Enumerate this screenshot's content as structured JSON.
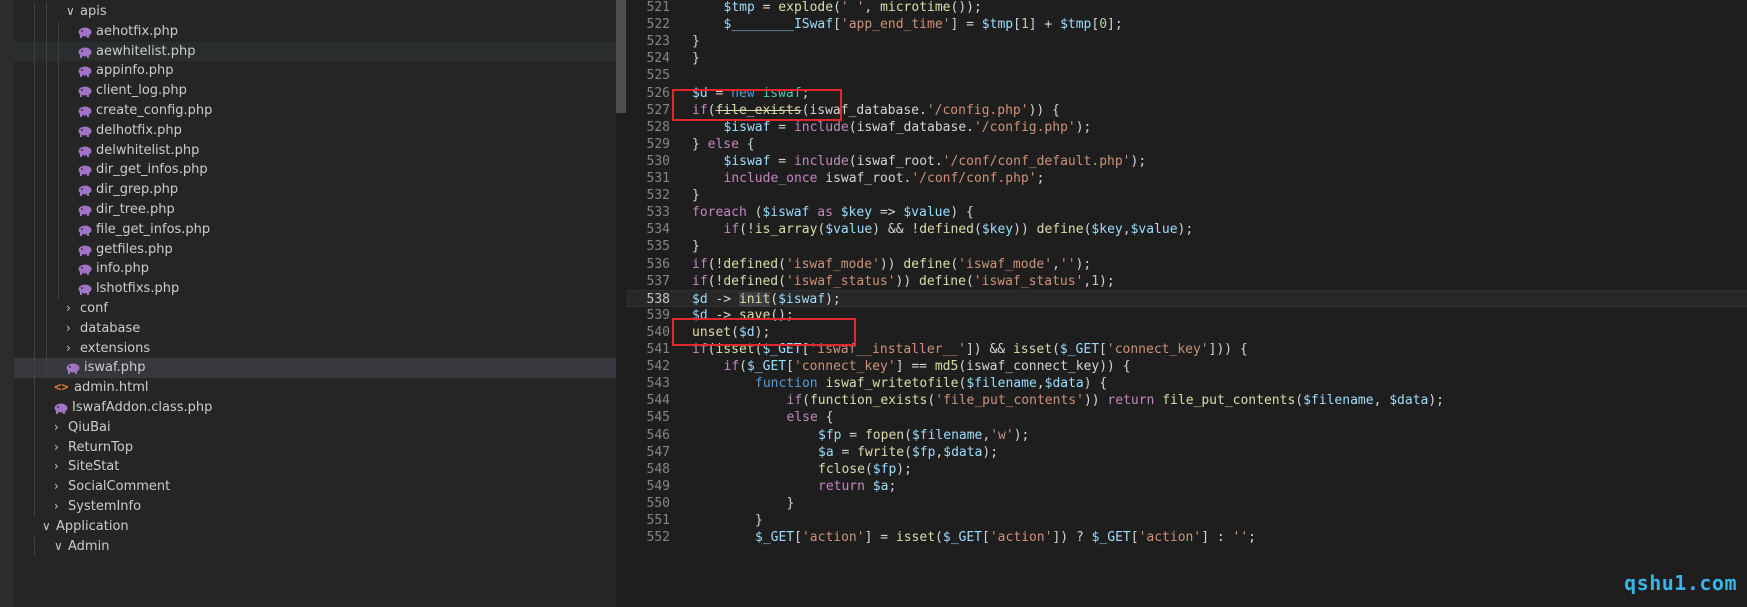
{
  "explorer": {
    "items": [
      {
        "label": "apis",
        "kind": "folder-open",
        "depth": 2
      },
      {
        "label": "aehotfix.php",
        "kind": "php",
        "depth": 3
      },
      {
        "label": "aewhitelist.php",
        "kind": "php",
        "depth": 3
      },
      {
        "label": "appinfo.php",
        "kind": "php",
        "depth": 3
      },
      {
        "label": "client_log.php",
        "kind": "php",
        "depth": 3
      },
      {
        "label": "create_config.php",
        "kind": "php",
        "depth": 3
      },
      {
        "label": "delhotfix.php",
        "kind": "php",
        "depth": 3
      },
      {
        "label": "delwhitelist.php",
        "kind": "php",
        "depth": 3
      },
      {
        "label": "dir_get_infos.php",
        "kind": "php",
        "depth": 3
      },
      {
        "label": "dir_grep.php",
        "kind": "php",
        "depth": 3
      },
      {
        "label": "dir_tree.php",
        "kind": "php",
        "depth": 3
      },
      {
        "label": "file_get_infos.php",
        "kind": "php",
        "depth": 3
      },
      {
        "label": "getfiles.php",
        "kind": "php",
        "depth": 3
      },
      {
        "label": "info.php",
        "kind": "php",
        "depth": 3
      },
      {
        "label": "lshotfixs.php",
        "kind": "php",
        "depth": 3
      },
      {
        "label": "conf",
        "kind": "folder",
        "depth": 2
      },
      {
        "label": "database",
        "kind": "folder",
        "depth": 2
      },
      {
        "label": "extensions",
        "kind": "folder",
        "depth": 2
      },
      {
        "label": "iswaf.php",
        "kind": "php",
        "depth": 2
      },
      {
        "label": "admin.html",
        "kind": "html",
        "depth": 1
      },
      {
        "label": "IswafAddon.class.php",
        "kind": "php",
        "depth": 1
      },
      {
        "label": "QiuBai",
        "kind": "folder",
        "depth": 1
      },
      {
        "label": "ReturnTop",
        "kind": "folder",
        "depth": 1
      },
      {
        "label": "SiteStat",
        "kind": "folder",
        "depth": 1
      },
      {
        "label": "SocialComment",
        "kind": "folder",
        "depth": 1
      },
      {
        "label": "SystemInfo",
        "kind": "folder",
        "depth": 1
      },
      {
        "label": "Application",
        "kind": "folder-open",
        "depth": 0
      },
      {
        "label": "Admin",
        "kind": "folder-open",
        "depth": 1
      }
    ],
    "selected_item": "iswaf.php",
    "hovered_item": "aewhitelist.php"
  },
  "editor": {
    "current_line": "538",
    "lines": [
      {
        "n": "521",
        "indent": 2,
        "t": [
          [
            "v",
            "$tmp"
          ],
          [
            "p",
            " = "
          ],
          [
            "f",
            "explode"
          ],
          [
            "p",
            "("
          ],
          [
            "s",
            "' '"
          ],
          [
            "p",
            ", "
          ],
          [
            "f",
            "microtime"
          ],
          [
            "p",
            "());"
          ]
        ]
      },
      {
        "n": "522",
        "indent": 2,
        "t": [
          [
            "v",
            "$________ISwaf"
          ],
          [
            "p",
            "["
          ],
          [
            "s",
            "'app_end_time'"
          ],
          [
            "p",
            "] = "
          ],
          [
            "v",
            "$tmp"
          ],
          [
            "p",
            "["
          ],
          [
            "n",
            "1"
          ],
          [
            "p",
            "] + "
          ],
          [
            "v",
            "$tmp"
          ],
          [
            "p",
            "["
          ],
          [
            "n",
            "0"
          ],
          [
            "p",
            "];"
          ]
        ]
      },
      {
        "n": "523",
        "indent": 1,
        "t": [
          [
            "p",
            "}"
          ]
        ]
      },
      {
        "n": "524",
        "indent": 1,
        "t": [
          [
            "p",
            "}"
          ]
        ]
      },
      {
        "n": "525",
        "indent": 0,
        "t": []
      },
      {
        "n": "526",
        "indent": 1,
        "t": [
          [
            "v",
            "$d"
          ],
          [
            "p",
            " = "
          ],
          [
            "b",
            "new"
          ],
          [
            "p",
            " "
          ],
          [
            "t",
            "iswaf"
          ],
          [
            "p",
            ";"
          ]
        ]
      },
      {
        "n": "527",
        "indent": 1,
        "t": [
          [
            "k",
            "if"
          ],
          [
            "p",
            "("
          ],
          [
            "fx",
            "file_exists"
          ],
          [
            "p",
            "(iswaf_database."
          ],
          [
            "s",
            "'/config.php'"
          ],
          [
            "p",
            ")) {"
          ]
        ]
      },
      {
        "n": "528",
        "indent": 2,
        "t": [
          [
            "v",
            "$iswaf"
          ],
          [
            "p",
            " = "
          ],
          [
            "k",
            "include"
          ],
          [
            "p",
            "(iswaf_database."
          ],
          [
            "s",
            "'/config.php'"
          ],
          [
            "p",
            ");"
          ]
        ]
      },
      {
        "n": "529",
        "indent": 1,
        "t": [
          [
            "p",
            "} "
          ],
          [
            "k",
            "else"
          ],
          [
            "p",
            " {"
          ]
        ]
      },
      {
        "n": "530",
        "indent": 2,
        "t": [
          [
            "v",
            "$iswaf"
          ],
          [
            "p",
            " = "
          ],
          [
            "k",
            "include"
          ],
          [
            "p",
            "(iswaf_root."
          ],
          [
            "s",
            "'/conf/conf_default.php'"
          ],
          [
            "p",
            ");"
          ]
        ]
      },
      {
        "n": "531",
        "indent": 2,
        "t": [
          [
            "k",
            "include_once"
          ],
          [
            "p",
            " iswaf_root."
          ],
          [
            "s",
            "'/conf/conf.php'"
          ],
          [
            "p",
            ";"
          ]
        ]
      },
      {
        "n": "532",
        "indent": 1,
        "t": [
          [
            "p",
            "}"
          ]
        ]
      },
      {
        "n": "533",
        "indent": 1,
        "t": [
          [
            "k",
            "foreach"
          ],
          [
            "p",
            " ("
          ],
          [
            "v",
            "$iswaf"
          ],
          [
            "p",
            " "
          ],
          [
            "k",
            "as"
          ],
          [
            "p",
            " "
          ],
          [
            "v",
            "$key"
          ],
          [
            "p",
            " => "
          ],
          [
            "v",
            "$value"
          ],
          [
            "p",
            ") {"
          ]
        ]
      },
      {
        "n": "534",
        "indent": 2,
        "t": [
          [
            "k",
            "if"
          ],
          [
            "p",
            "(!"
          ],
          [
            "f",
            "is_array"
          ],
          [
            "p",
            "("
          ],
          [
            "v",
            "$value"
          ],
          [
            "p",
            ") && !"
          ],
          [
            "f",
            "defined"
          ],
          [
            "p",
            "("
          ],
          [
            "v",
            "$key"
          ],
          [
            "p",
            ")) "
          ],
          [
            "f",
            "define"
          ],
          [
            "p",
            "("
          ],
          [
            "v",
            "$key"
          ],
          [
            "p",
            ","
          ],
          [
            "v",
            "$value"
          ],
          [
            "p",
            ");"
          ]
        ]
      },
      {
        "n": "535",
        "indent": 1,
        "t": [
          [
            "p",
            "}"
          ]
        ]
      },
      {
        "n": "536",
        "indent": 1,
        "t": [
          [
            "k",
            "if"
          ],
          [
            "p",
            "(!"
          ],
          [
            "f",
            "defined"
          ],
          [
            "p",
            "("
          ],
          [
            "s",
            "'iswaf_mode'"
          ],
          [
            "p",
            ")) "
          ],
          [
            "f",
            "define"
          ],
          [
            "p",
            "("
          ],
          [
            "s",
            "'iswaf_mode'"
          ],
          [
            "p",
            ","
          ],
          [
            "s",
            "''"
          ],
          [
            "p",
            ");"
          ]
        ]
      },
      {
        "n": "537",
        "indent": 1,
        "t": [
          [
            "k",
            "if"
          ],
          [
            "p",
            "(!"
          ],
          [
            "f",
            "defined"
          ],
          [
            "p",
            "("
          ],
          [
            "s",
            "'iswaf_status'"
          ],
          [
            "p",
            ")) "
          ],
          [
            "f",
            "define"
          ],
          [
            "p",
            "("
          ],
          [
            "s",
            "'iswaf_status'"
          ],
          [
            "p",
            ","
          ],
          [
            "n",
            "1"
          ],
          [
            "p",
            ");"
          ]
        ]
      },
      {
        "n": "538",
        "indent": 1,
        "t": [
          [
            "v",
            "$d"
          ],
          [
            "p",
            " -> "
          ],
          [
            "fh",
            "init"
          ],
          [
            "p",
            "("
          ],
          [
            "v",
            "$iswaf"
          ],
          [
            "p",
            ");"
          ]
        ]
      },
      {
        "n": "539",
        "indent": 1,
        "t": [
          [
            "v",
            "$d"
          ],
          [
            "p",
            " -> "
          ],
          [
            "f",
            "save"
          ],
          [
            "p",
            "();"
          ]
        ]
      },
      {
        "n": "540",
        "indent": 1,
        "t": [
          [
            "f",
            "unset"
          ],
          [
            "p",
            "("
          ],
          [
            "v",
            "$d"
          ],
          [
            "p",
            ");"
          ]
        ]
      },
      {
        "n": "541",
        "indent": 1,
        "t": [
          [
            "k",
            "if"
          ],
          [
            "p",
            "("
          ],
          [
            "f",
            "isset"
          ],
          [
            "p",
            "("
          ],
          [
            "v",
            "$_GET"
          ],
          [
            "p",
            "["
          ],
          [
            "s",
            "'iswaf__installer__'"
          ],
          [
            "p",
            "]) && "
          ],
          [
            "f",
            "isset"
          ],
          [
            "p",
            "("
          ],
          [
            "v",
            "$_GET"
          ],
          [
            "p",
            "["
          ],
          [
            "s",
            "'connect_key'"
          ],
          [
            "p",
            "])) {"
          ]
        ]
      },
      {
        "n": "542",
        "indent": 2,
        "t": [
          [
            "k",
            "if"
          ],
          [
            "p",
            "("
          ],
          [
            "v",
            "$_GET"
          ],
          [
            "p",
            "["
          ],
          [
            "s",
            "'connect_key'"
          ],
          [
            "p",
            "] == "
          ],
          [
            "f",
            "md5"
          ],
          [
            "p",
            "(iswaf_connect_key)) {"
          ]
        ]
      },
      {
        "n": "543",
        "indent": 3,
        "t": [
          [
            "b",
            "function"
          ],
          [
            "p",
            " "
          ],
          [
            "f",
            "iswaf_writetofile"
          ],
          [
            "p",
            "("
          ],
          [
            "v",
            "$filename"
          ],
          [
            "p",
            ","
          ],
          [
            "v",
            "$data"
          ],
          [
            "p",
            ") {"
          ]
        ]
      },
      {
        "n": "544",
        "indent": 4,
        "t": [
          [
            "k",
            "if"
          ],
          [
            "p",
            "("
          ],
          [
            "f",
            "function_exists"
          ],
          [
            "p",
            "("
          ],
          [
            "s",
            "'file_put_contents'"
          ],
          [
            "p",
            ")) "
          ],
          [
            "k",
            "return"
          ],
          [
            "p",
            " "
          ],
          [
            "f",
            "file_put_contents"
          ],
          [
            "p",
            "("
          ],
          [
            "v",
            "$filename"
          ],
          [
            "p",
            ", "
          ],
          [
            "v",
            "$data"
          ],
          [
            "p",
            ");"
          ]
        ]
      },
      {
        "n": "545",
        "indent": 4,
        "t": [
          [
            "k",
            "else"
          ],
          [
            "p",
            " {"
          ]
        ]
      },
      {
        "n": "546",
        "indent": 5,
        "t": [
          [
            "v",
            "$fp"
          ],
          [
            "p",
            " = "
          ],
          [
            "f",
            "fopen"
          ],
          [
            "p",
            "("
          ],
          [
            "v",
            "$filename"
          ],
          [
            "p",
            ","
          ],
          [
            "s",
            "'w'"
          ],
          [
            "p",
            ");"
          ]
        ]
      },
      {
        "n": "547",
        "indent": 5,
        "t": [
          [
            "v",
            "$a"
          ],
          [
            "p",
            " = "
          ],
          [
            "f",
            "fwrite"
          ],
          [
            "p",
            "("
          ],
          [
            "v",
            "$fp"
          ],
          [
            "p",
            ","
          ],
          [
            "v",
            "$data"
          ],
          [
            "p",
            ");"
          ]
        ]
      },
      {
        "n": "548",
        "indent": 5,
        "t": [
          [
            "f",
            "fclose"
          ],
          [
            "p",
            "("
          ],
          [
            "v",
            "$fp"
          ],
          [
            "p",
            ");"
          ]
        ]
      },
      {
        "n": "549",
        "indent": 5,
        "t": [
          [
            "k",
            "return"
          ],
          [
            "p",
            " "
          ],
          [
            "v",
            "$a"
          ],
          [
            "p",
            ";"
          ]
        ]
      },
      {
        "n": "550",
        "indent": 4,
        "t": [
          [
            "p",
            "}"
          ]
        ]
      },
      {
        "n": "551",
        "indent": 3,
        "t": [
          [
            "p",
            "}"
          ]
        ]
      },
      {
        "n": "552",
        "indent": 3,
        "t": [
          [
            "v",
            "$_GET"
          ],
          [
            "p",
            "["
          ],
          [
            "s",
            "'action'"
          ],
          [
            "p",
            "] = "
          ],
          [
            "f",
            "isset"
          ],
          [
            "p",
            "("
          ],
          [
            "v",
            "$_GET"
          ],
          [
            "p",
            "["
          ],
          [
            "s",
            "'action'"
          ],
          [
            "p",
            "]) ? "
          ],
          [
            "v",
            "$_GET"
          ],
          [
            "p",
            "["
          ],
          [
            "s",
            "'action'"
          ],
          [
            "p",
            "] : "
          ],
          [
            "s",
            "''"
          ],
          [
            "p",
            ";"
          ]
        ]
      }
    ]
  },
  "annotations": {
    "boxed_lines": [
      "526",
      "538"
    ],
    "color": "#e0272c"
  },
  "watermark": "qshu1.com",
  "theme": {
    "background": "#1e1e1e",
    "sidebar": "#252526",
    "variable": "#9cdcfe",
    "function": "#dcdcaa",
    "string": "#ce9178",
    "keyword": "#c586c0",
    "php_icon": "#a074c4"
  }
}
